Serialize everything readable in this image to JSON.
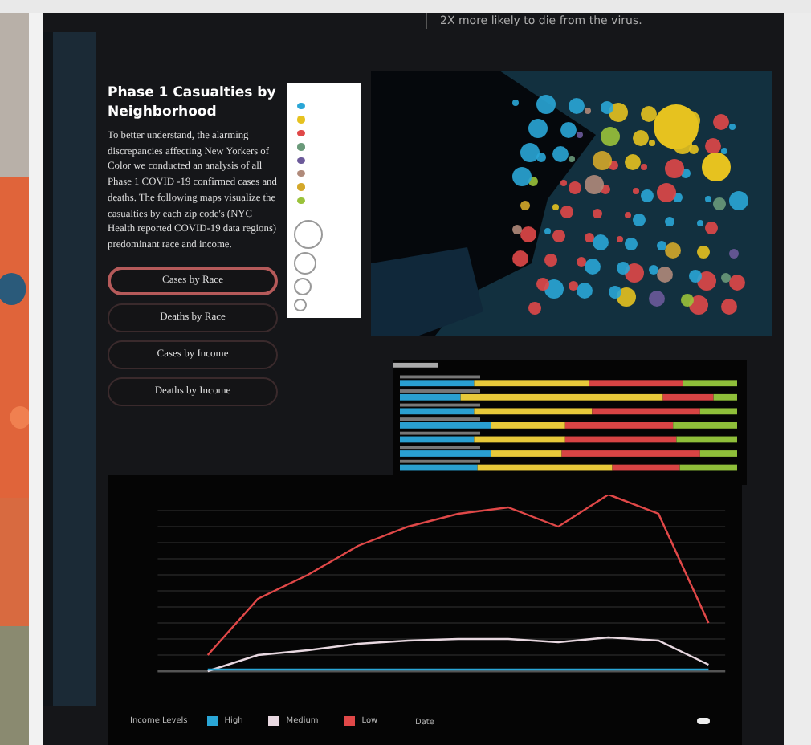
{
  "intro_text": "2X more likely to die from the virus.",
  "section": {
    "title": "Phase 1 Casualties by Neighborhood",
    "body": "To better understand, the alarming discrepancies affecting New Yorkers of Color we conducted an analysis of all Phase 1 COVID -19 confirmed cases and deaths. The following maps visualize the casualties by each zip code's (NYC Health reported COVID-19 data regions) predominant race and income."
  },
  "buttons": [
    {
      "label": "Cases by Race",
      "selected": true
    },
    {
      "label": "Deaths by Race",
      "selected": false
    },
    {
      "label": "Cases by Income",
      "selected": false
    },
    {
      "label": "Deaths by Income",
      "selected": false
    }
  ],
  "map_legend": [
    {
      "color": "#2aa6d6"
    },
    {
      "color": "#e6c21f"
    },
    {
      "color": "#e04848"
    },
    {
      "color": "#6a9a7a"
    },
    {
      "color": "#6c5a9a"
    },
    {
      "color": "#b08a7a"
    },
    {
      "color": "#d4a82a"
    },
    {
      "color": "#9ac23a"
    }
  ],
  "line_chart": {
    "xlabel": "Date",
    "legend_title": "Income Levels",
    "series": [
      {
        "name": "High",
        "color": "#2aa6d6"
      },
      {
        "name": "Medium",
        "color": "#e8d8e0"
      },
      {
        "name": "Low",
        "color": "#e04848"
      }
    ]
  }
}
